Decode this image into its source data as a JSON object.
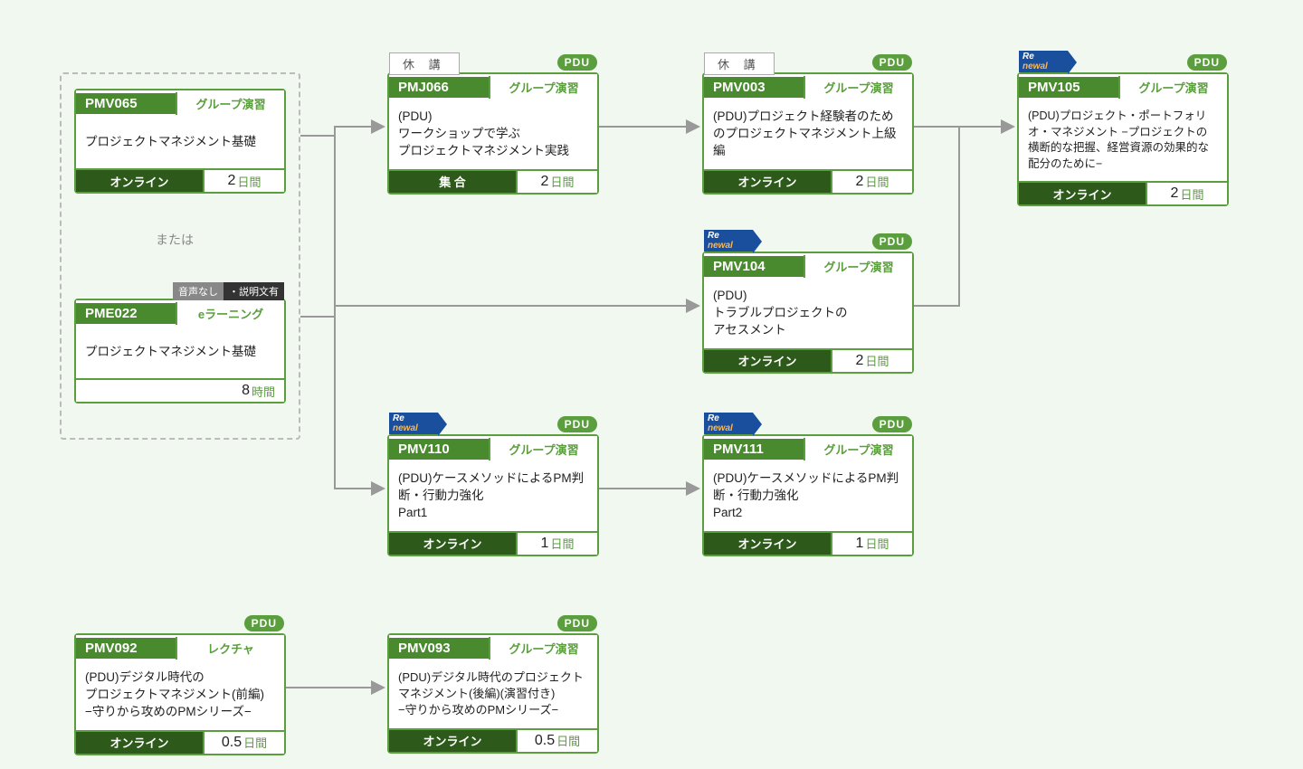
{
  "labels": {
    "or": "または",
    "pdu": "PDU",
    "cancelled": "休 講",
    "renewal_re": "Re",
    "renewal_newal": "newal",
    "audio_none": "音声なし",
    "audio_desc": "・説明文有"
  },
  "courses": {
    "pmv065": {
      "code": "PMV065",
      "type": "グループ演習",
      "title": "プロジェクトマネジメント基礎",
      "delivery": "オンライン",
      "duration_num": "2",
      "duration_unit": "日間"
    },
    "pme022": {
      "code": "PME022",
      "type": "eラーニング",
      "title": "プロジェクトマネジメント基礎",
      "duration_num": "8",
      "duration_unit": "時間"
    },
    "pmj066": {
      "code": "PMJ066",
      "type": "グループ演習",
      "title": "(PDU)\nワークショップで学ぶ\nプロジェクトマネジメント実践",
      "delivery": "集 合",
      "duration_num": "2",
      "duration_unit": "日間"
    },
    "pmv003": {
      "code": "PMV003",
      "type": "グループ演習",
      "title": "(PDU)プロジェクト経験者のためのプロジェクトマネジメント上級編",
      "delivery": "オンライン",
      "duration_num": "2",
      "duration_unit": "日間"
    },
    "pmv105": {
      "code": "PMV105",
      "type": "グループ演習",
      "title": "(PDU)プロジェクト・ポートフォリオ・マネジメント −プロジェクトの横断的な把握、経営資源の効果的な配分のために−",
      "delivery": "オンライン",
      "duration_num": "2",
      "duration_unit": "日間"
    },
    "pmv104": {
      "code": "PMV104",
      "type": "グループ演習",
      "title": "(PDU)\nトラブルプロジェクトの\nアセスメント",
      "delivery": "オンライン",
      "duration_num": "2",
      "duration_unit": "日間"
    },
    "pmv110": {
      "code": "PMV110",
      "type": "グループ演習",
      "title": "(PDU)ケースメソッドによるPM判断・行動力強化\nPart1",
      "delivery": "オンライン",
      "duration_num": "1",
      "duration_unit": "日間"
    },
    "pmv111": {
      "code": "PMV111",
      "type": "グループ演習",
      "title": "(PDU)ケースメソッドによるPM判断・行動力強化\nPart2",
      "delivery": "オンライン",
      "duration_num": "1",
      "duration_unit": "日間"
    },
    "pmv092": {
      "code": "PMV092",
      "type": "レクチャ",
      "title": "(PDU)デジタル時代の\nプロジェクトマネジメント(前編)\n−守りから攻めのPMシリーズ−",
      "delivery": "オンライン",
      "duration_num": "0.5",
      "duration_unit": "日間"
    },
    "pmv093": {
      "code": "PMV093",
      "type": "グループ演習",
      "title": "(PDU)デジタル時代のプロジェクトマネジメント(後編)(演習付き)\n−守りから攻めのPMシリーズ−",
      "delivery": "オンライン",
      "duration_num": "0.5",
      "duration_unit": "日間"
    }
  }
}
